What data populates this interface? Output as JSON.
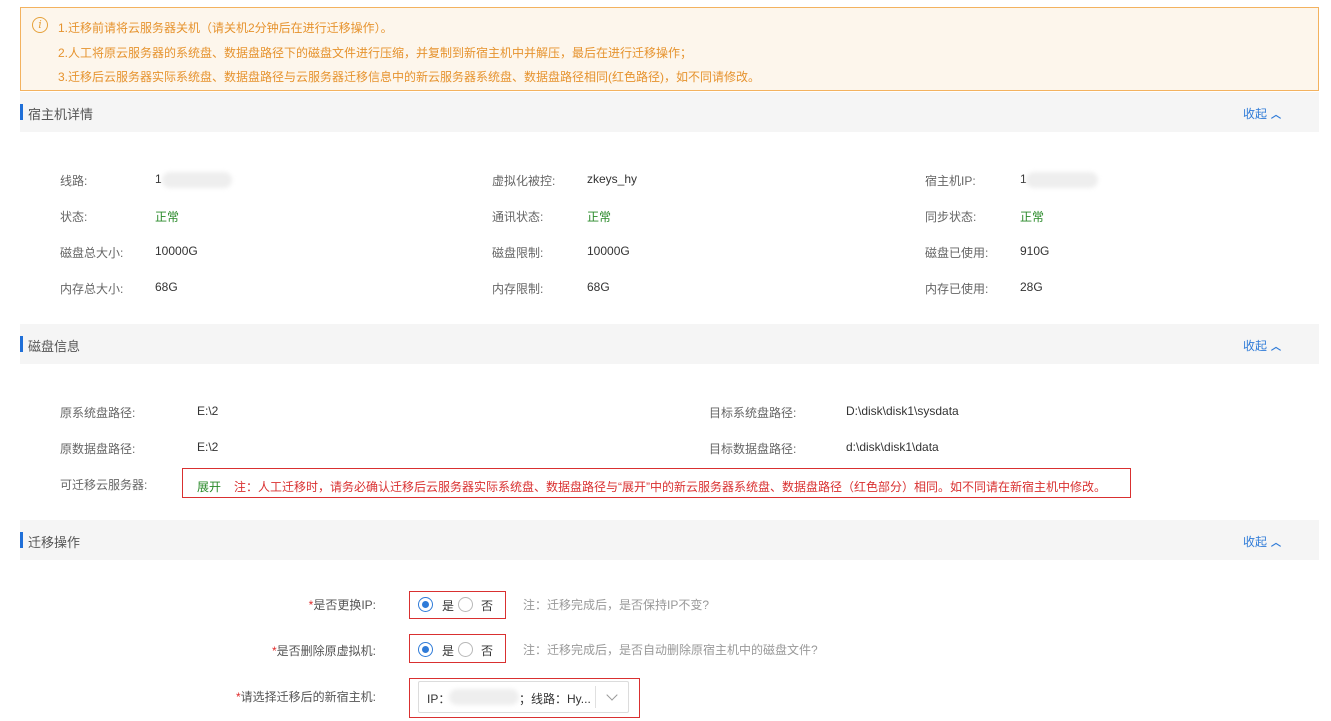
{
  "notice": {
    "icon": "info-icon",
    "line1": "1.迁移前请将云服务器关机（请关机2分钟后在进行迁移操作）。",
    "line2": "2.人工将原云服务器的系统盘、数据盘路径下的磁盘文件进行压缩，并复制到新宿主机中并解压，最后在进行迁移操作；",
    "line3": "3.迁移后云服务器实际系统盘、数据盘路径与云服务器迁移信息中的新云服务器系统盘、数据盘路径相同(红色路径)，如不同请修改。"
  },
  "host_section": {
    "title": "宿主机详情",
    "collapse": "收起",
    "line_label": "线路:",
    "line_value": "1",
    "virt_label": "虚拟化被控:",
    "virt_value": "zkeys_hy",
    "ip_label": "宿主机IP:",
    "ip_value": "1",
    "status_label": "状态:",
    "status_value": "正常",
    "comm_label": "通讯状态:",
    "comm_value": "正常",
    "sync_label": "同步状态:",
    "sync_value": "正常",
    "disk_total_label": "磁盘总大小:",
    "disk_total_value": "10000G",
    "disk_limit_label": "磁盘限制:",
    "disk_limit_value": "10000G",
    "disk_used_label": "磁盘已使用:",
    "disk_used_value": "910G",
    "mem_total_label": "内存总大小:",
    "mem_total_value": "68G",
    "mem_limit_label": "内存限制:",
    "mem_limit_value": "68G",
    "mem_used_label": "内存已使用:",
    "mem_used_value": "28G"
  },
  "disk_section": {
    "title": "磁盘信息",
    "collapse": "收起",
    "src_sys_label": "原系统盘路径:",
    "src_sys_value": "E:\\2",
    "dst_sys_label": "目标系统盘路径:",
    "dst_sys_value": "D:\\disk\\disk1\\sysdata",
    "src_data_label": "原数据盘路径:",
    "src_data_value": "E:\\2",
    "dst_data_label": "目标数据盘路径:",
    "dst_data_value": "d:\\disk\\disk1\\data",
    "migratable_label": "可迁移云服务器:",
    "expand": "展开",
    "migratable_note": "注：人工迁移时，请务必确认迁移后云服务器实际系统盘、数据盘路径与“展开”中的新云服务器系统盘、数据盘路径（红色部分）相同。如不同请在新宿主机中修改。"
  },
  "migrate_section": {
    "title": "迁移操作",
    "collapse": "收起",
    "required_mark": "*",
    "change_ip_label": "是否更换IP:",
    "change_ip_hint": "注：迁移完成后，是否保持IP不变?",
    "delete_vm_label": "是否删除原虚拟机:",
    "delete_vm_hint": "注：迁移完成后，是否自动删除原宿主机中的磁盘文件?",
    "yes": "是",
    "no": "否",
    "new_host_label": "请选择迁移后的新宿主机:",
    "new_host_ip_prefix": "IP：",
    "new_host_suffix": "；线路：Hy..."
  },
  "colors": {
    "accent": "#2f7bd8",
    "warning": "#e6932e",
    "danger": "#d93030",
    "success": "#2a8a2a"
  }
}
